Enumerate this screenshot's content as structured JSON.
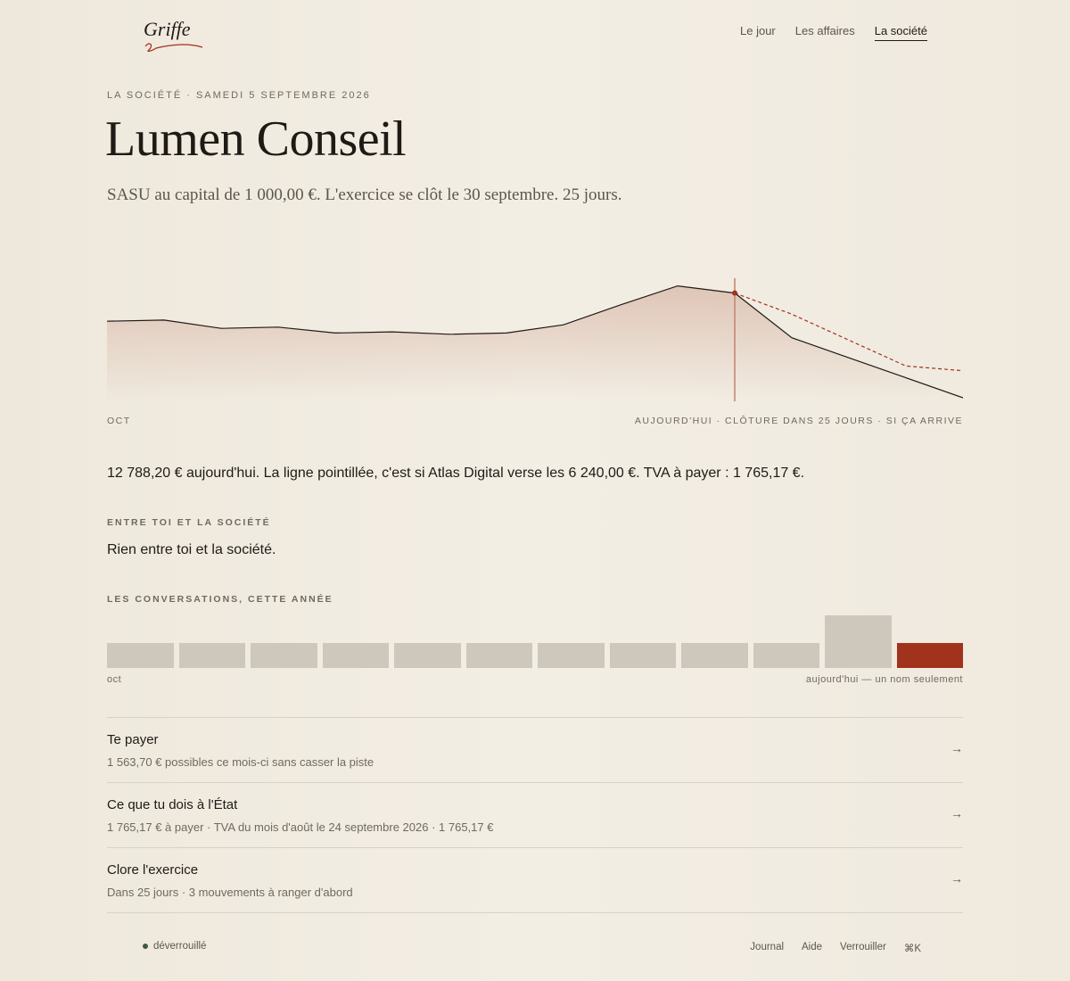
{
  "brand": {
    "logo": "Griffe"
  },
  "nav": {
    "items": [
      {
        "label": "Le jour"
      },
      {
        "label": "Les affaires"
      },
      {
        "label": "La société"
      }
    ]
  },
  "hero": {
    "eyebrow": "LA SOCIÉTÉ · SAMEDI 5 SEPTEMBRE 2026",
    "title": "Lumen Conseil",
    "subtitle": "SASU au capital de 1 000,00 €. L'exercice se clôt le 30 septembre. 25 jours."
  },
  "chart_data": {
    "type": "line",
    "x": [
      0,
      1,
      2,
      3,
      4,
      5,
      6,
      7,
      8,
      9,
      10,
      11,
      12,
      13,
      14,
      15
    ],
    "series": [
      {
        "values": [
          0.68,
          0.69,
          0.62,
          0.63,
          0.58,
          0.59,
          0.57,
          0.58,
          0.65,
          0.82,
          0.98,
          0.92,
          0.54,
          0.37,
          0.2,
          0.03
        ]
      },
      {
        "values": [
          null,
          null,
          null,
          null,
          null,
          null,
          null,
          null,
          null,
          null,
          null,
          0.92,
          0.74,
          0.52,
          0.3,
          0.26
        ]
      }
    ],
    "today_index": 11,
    "label_left": "OCT",
    "label_right": "AUJOURD'HUI · CLÔTURE DANS 25 JOURS · SI ÇA ARRIVE",
    "colors": {
      "line": "#1e1b16",
      "projection": "#a1321c",
      "marker": "#a1321c",
      "fill": "#d8b8a8"
    }
  },
  "summary": "12 788,20 € aujourd'hui. La ligne pointillée, c'est si Atlas Digital verse les 6 240,00 €. TVA à payer : 1 765,17 €.",
  "between": {
    "label": "ENTRE TOI ET LA SOCIÉTÉ",
    "text": "Rien entre toi et la société."
  },
  "conversations": {
    "label": "LES CONVERSATIONS, CETTE ANNÉE",
    "values": [
      1,
      1,
      1,
      1,
      1,
      1,
      1,
      1,
      1,
      1,
      2,
      1
    ],
    "highlight_index": 11,
    "label_left": "oct",
    "label_right": "aujourd'hui — un nom seulement",
    "colors": {
      "bar": "#cdc7bc",
      "highlight": "#a1321c"
    }
  },
  "actions": [
    {
      "title": "Te payer",
      "subtitle": "1 563,70 € possibles ce mois-ci sans casser la piste",
      "arrow": "→"
    },
    {
      "title": "Ce que tu dois à l'État",
      "subtitle": "1 765,17 € à payer · TVA du mois d'août le 24 septembre 2026 · 1 765,17 €",
      "arrow": "→"
    },
    {
      "title": "Clore l'exercice",
      "subtitle": "Dans 25 jours · 3 mouvements à ranger d'abord",
      "arrow": "→"
    }
  ],
  "footer": {
    "status": "déverrouillé",
    "links": [
      {
        "label": "Journal"
      },
      {
        "label": "Aide"
      },
      {
        "label": "Verrouiller"
      },
      {
        "label": "⌘K"
      }
    ]
  }
}
